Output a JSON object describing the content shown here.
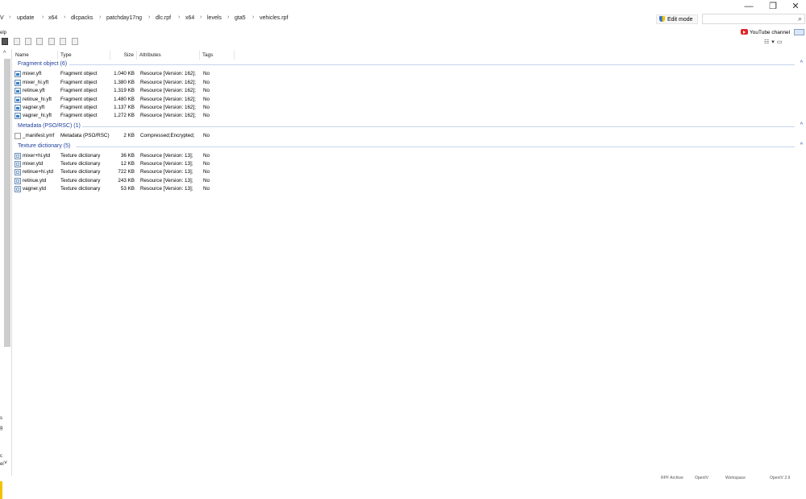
{
  "window": {
    "minimize": "—",
    "restore": "❐",
    "close": "✕"
  },
  "address": {
    "left_fragment": "V",
    "crumbs": [
      "update",
      "x64",
      "dlcpacks",
      "patchday17ng",
      "dlc.rpf",
      "x64",
      "levels",
      "gta5",
      "vehicles.rpf"
    ],
    "edit_mode_label": "Edit mode",
    "search_placeholder": ""
  },
  "menu_fragment": "elp",
  "youtube_label": "YouTube channel",
  "columns": {
    "name": "Name",
    "type": "Type",
    "size": "Size",
    "attributes": "Attributes",
    "tags": "Tags"
  },
  "groups": [
    {
      "title": "Fragment object (6)",
      "icon": "fragment-file-icon",
      "rows": [
        [
          "mixer.yft",
          "Fragment object",
          "1.040 KB",
          "Resource [Version: 162];",
          "No"
        ],
        [
          "mixer_hi.yft",
          "Fragment object",
          "1.380 KB",
          "Resource [Version: 162];",
          "No"
        ],
        [
          "retinue.yft",
          "Fragment object",
          "1.319 KB",
          "Resource [Version: 162];",
          "No"
        ],
        [
          "retinue_hi.yft",
          "Fragment object",
          "1.480 KB",
          "Resource [Version: 162];",
          "No"
        ],
        [
          "vagner.yft",
          "Fragment object",
          "1.137 KB",
          "Resource [Version: 162];",
          "No"
        ],
        [
          "vagner_hi.yft",
          "Fragment object",
          "1.272 KB",
          "Resource [Version: 162];",
          "No"
        ]
      ]
    },
    {
      "title": "Metadata (PSO/RSC) (1)",
      "icon": "metadata-file-icon",
      "rows": [
        [
          "_manifest.ymf",
          "Metadata (PSO/RSC)",
          "2 KB",
          "Compressed;Encrypted;",
          "No"
        ]
      ]
    },
    {
      "title": "Texture dictionary (5)",
      "icon": "texture-file-icon",
      "rows": [
        [
          "mixer+hi.ytd",
          "Texture dictionary",
          "36 KB",
          "Resource [Version: 13];",
          "No"
        ],
        [
          "mixer.ytd",
          "Texture dictionary",
          "12 KB",
          "Resource [Version: 13];",
          "No"
        ],
        [
          "retinue+hi.ytd",
          "Texture dictionary",
          "722 KB",
          "Resource [Version: 13];",
          "No"
        ],
        [
          "retinue.ytd",
          "Texture dictionary",
          "243 KB",
          "Resource [Version: 13];",
          "No"
        ],
        [
          "vagner.ytd",
          "Texture dictionary",
          "53 KB",
          "Resource [Version: 13];",
          "No"
        ]
      ]
    }
  ],
  "left_fragments": [
    "s",
    "g",
    "c",
    "el"
  ],
  "status_fragments": [
    "RPF Archive",
    "OpenIV",
    "Workspace",
    "OpenIV 2.9"
  ],
  "colors": {
    "group_header": "#1e3f9e",
    "accent": "#2f7fc8"
  }
}
